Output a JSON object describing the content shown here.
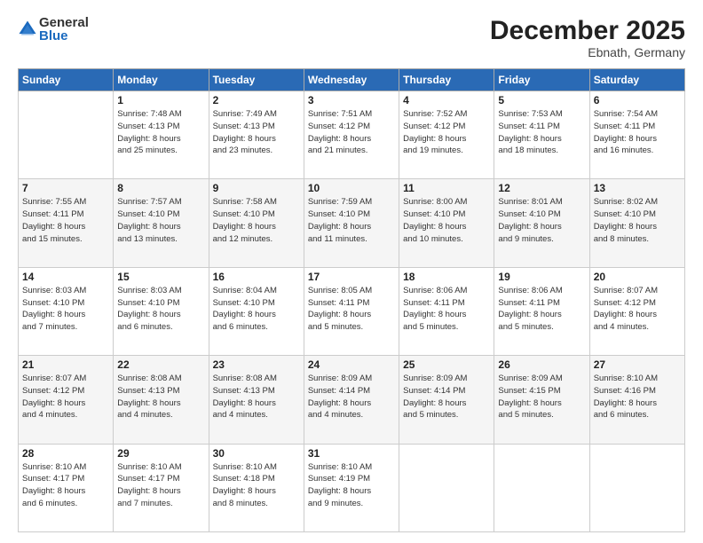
{
  "logo": {
    "general": "General",
    "blue": "Blue"
  },
  "header": {
    "month": "December 2025",
    "location": "Ebnath, Germany"
  },
  "weekdays": [
    "Sunday",
    "Monday",
    "Tuesday",
    "Wednesday",
    "Thursday",
    "Friday",
    "Saturday"
  ],
  "weeks": [
    [
      {
        "day": "",
        "info": ""
      },
      {
        "day": "1",
        "info": "Sunrise: 7:48 AM\nSunset: 4:13 PM\nDaylight: 8 hours\nand 25 minutes."
      },
      {
        "day": "2",
        "info": "Sunrise: 7:49 AM\nSunset: 4:13 PM\nDaylight: 8 hours\nand 23 minutes."
      },
      {
        "day": "3",
        "info": "Sunrise: 7:51 AM\nSunset: 4:12 PM\nDaylight: 8 hours\nand 21 minutes."
      },
      {
        "day": "4",
        "info": "Sunrise: 7:52 AM\nSunset: 4:12 PM\nDaylight: 8 hours\nand 19 minutes."
      },
      {
        "day": "5",
        "info": "Sunrise: 7:53 AM\nSunset: 4:11 PM\nDaylight: 8 hours\nand 18 minutes."
      },
      {
        "day": "6",
        "info": "Sunrise: 7:54 AM\nSunset: 4:11 PM\nDaylight: 8 hours\nand 16 minutes."
      }
    ],
    [
      {
        "day": "7",
        "info": "Sunrise: 7:55 AM\nSunset: 4:11 PM\nDaylight: 8 hours\nand 15 minutes."
      },
      {
        "day": "8",
        "info": "Sunrise: 7:57 AM\nSunset: 4:10 PM\nDaylight: 8 hours\nand 13 minutes."
      },
      {
        "day": "9",
        "info": "Sunrise: 7:58 AM\nSunset: 4:10 PM\nDaylight: 8 hours\nand 12 minutes."
      },
      {
        "day": "10",
        "info": "Sunrise: 7:59 AM\nSunset: 4:10 PM\nDaylight: 8 hours\nand 11 minutes."
      },
      {
        "day": "11",
        "info": "Sunrise: 8:00 AM\nSunset: 4:10 PM\nDaylight: 8 hours\nand 10 minutes."
      },
      {
        "day": "12",
        "info": "Sunrise: 8:01 AM\nSunset: 4:10 PM\nDaylight: 8 hours\nand 9 minutes."
      },
      {
        "day": "13",
        "info": "Sunrise: 8:02 AM\nSunset: 4:10 PM\nDaylight: 8 hours\nand 8 minutes."
      }
    ],
    [
      {
        "day": "14",
        "info": "Sunrise: 8:03 AM\nSunset: 4:10 PM\nDaylight: 8 hours\nand 7 minutes."
      },
      {
        "day": "15",
        "info": "Sunrise: 8:03 AM\nSunset: 4:10 PM\nDaylight: 8 hours\nand 6 minutes."
      },
      {
        "day": "16",
        "info": "Sunrise: 8:04 AM\nSunset: 4:10 PM\nDaylight: 8 hours\nand 6 minutes."
      },
      {
        "day": "17",
        "info": "Sunrise: 8:05 AM\nSunset: 4:11 PM\nDaylight: 8 hours\nand 5 minutes."
      },
      {
        "day": "18",
        "info": "Sunrise: 8:06 AM\nSunset: 4:11 PM\nDaylight: 8 hours\nand 5 minutes."
      },
      {
        "day": "19",
        "info": "Sunrise: 8:06 AM\nSunset: 4:11 PM\nDaylight: 8 hours\nand 5 minutes."
      },
      {
        "day": "20",
        "info": "Sunrise: 8:07 AM\nSunset: 4:12 PM\nDaylight: 8 hours\nand 4 minutes."
      }
    ],
    [
      {
        "day": "21",
        "info": "Sunrise: 8:07 AM\nSunset: 4:12 PM\nDaylight: 8 hours\nand 4 minutes."
      },
      {
        "day": "22",
        "info": "Sunrise: 8:08 AM\nSunset: 4:13 PM\nDaylight: 8 hours\nand 4 minutes."
      },
      {
        "day": "23",
        "info": "Sunrise: 8:08 AM\nSunset: 4:13 PM\nDaylight: 8 hours\nand 4 minutes."
      },
      {
        "day": "24",
        "info": "Sunrise: 8:09 AM\nSunset: 4:14 PM\nDaylight: 8 hours\nand 4 minutes."
      },
      {
        "day": "25",
        "info": "Sunrise: 8:09 AM\nSunset: 4:14 PM\nDaylight: 8 hours\nand 5 minutes."
      },
      {
        "day": "26",
        "info": "Sunrise: 8:09 AM\nSunset: 4:15 PM\nDaylight: 8 hours\nand 5 minutes."
      },
      {
        "day": "27",
        "info": "Sunrise: 8:10 AM\nSunset: 4:16 PM\nDaylight: 8 hours\nand 6 minutes."
      }
    ],
    [
      {
        "day": "28",
        "info": "Sunrise: 8:10 AM\nSunset: 4:17 PM\nDaylight: 8 hours\nand 6 minutes."
      },
      {
        "day": "29",
        "info": "Sunrise: 8:10 AM\nSunset: 4:17 PM\nDaylight: 8 hours\nand 7 minutes."
      },
      {
        "day": "30",
        "info": "Sunrise: 8:10 AM\nSunset: 4:18 PM\nDaylight: 8 hours\nand 8 minutes."
      },
      {
        "day": "31",
        "info": "Sunrise: 8:10 AM\nSunset: 4:19 PM\nDaylight: 8 hours\nand 9 minutes."
      },
      {
        "day": "",
        "info": ""
      },
      {
        "day": "",
        "info": ""
      },
      {
        "day": "",
        "info": ""
      }
    ]
  ]
}
